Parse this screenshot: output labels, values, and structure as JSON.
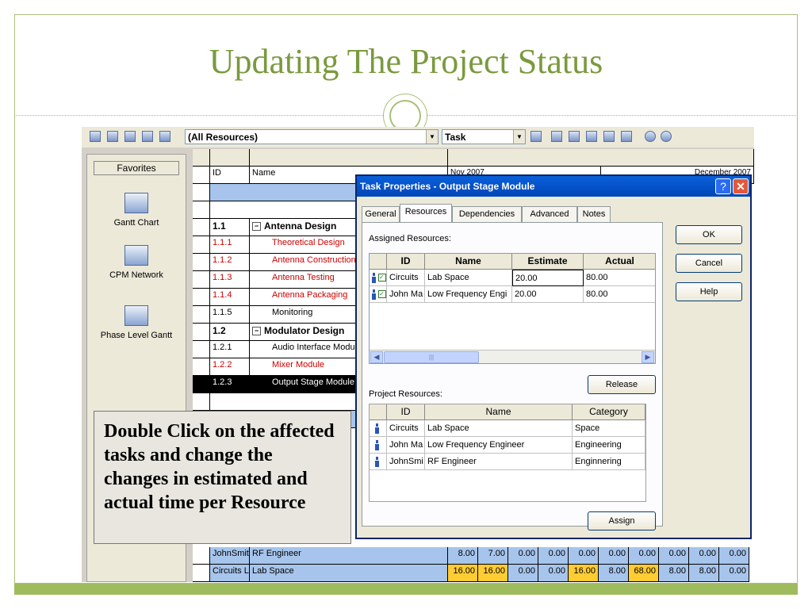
{
  "slide": {
    "title": "Updating The Project Status",
    "callout": "Double Click on the affected tasks and change the changes in estimated and actual time per Resource"
  },
  "toolbar": {
    "resource_filter": "(All Resources)",
    "view_filter": "Task"
  },
  "favorites": {
    "header": "Favorites",
    "items": [
      {
        "label": "Gantt Chart",
        "icon": "gantt-chart-icon"
      },
      {
        "label": "CPM Network",
        "icon": "cpm-network-icon"
      },
      {
        "label": "Phase Level Gantt",
        "icon": "phase-gantt-icon"
      }
    ]
  },
  "task_grid": {
    "col_id": "ID",
    "col_name": "Name",
    "timeline_months": [
      "Nov 2007",
      "December 2007"
    ],
    "rows": [
      {
        "id": "1.1",
        "name": "Antenna Design",
        "style": "summary"
      },
      {
        "id": "1.1.1",
        "name": "Theoretical Design",
        "style": "red"
      },
      {
        "id": "1.1.2",
        "name": "Antenna Construction",
        "style": "red"
      },
      {
        "id": "1.1.3",
        "name": "Antenna Testing",
        "style": "red"
      },
      {
        "id": "1.1.4",
        "name": "Antenna Packaging",
        "style": "red"
      },
      {
        "id": "1.1.5",
        "name": "Monitoring",
        "style": "normal"
      },
      {
        "id": "1.2",
        "name": "Modulator Design",
        "style": "summary"
      },
      {
        "id": "1.2.1",
        "name": "Audio Interface Module",
        "style": "normal"
      },
      {
        "id": "1.2.2",
        "name": "Mixer Module",
        "style": "red"
      },
      {
        "id": "1.2.3",
        "name": "Output Stage Module",
        "style": "selected"
      }
    ]
  },
  "resource_usage": {
    "rows": [
      {
        "id": "JohnSmith",
        "name": "RF Engineer",
        "values": [
          "8.00",
          "7.00",
          "0.00",
          "0.00",
          "0.00",
          "0.00",
          "0.00",
          "0.00",
          "0.00",
          "0.00"
        ],
        "highlight": [
          false,
          false,
          false,
          false,
          false,
          false,
          false,
          false,
          false,
          false
        ]
      },
      {
        "id": "Circuits L",
        "name": "Lab Space",
        "values": [
          "16.00",
          "16.00",
          "0.00",
          "0.00",
          "16.00",
          "8.00",
          "68.00",
          "8.00",
          "8.00",
          "0.00"
        ],
        "highlight": [
          true,
          true,
          false,
          false,
          true,
          false,
          true,
          false,
          false,
          false
        ]
      }
    ]
  },
  "dialog": {
    "title": "Task Properties - Output Stage Module",
    "help_glyph": "?",
    "close_glyph": "✕",
    "tabs": [
      "General",
      "Resources",
      "Dependencies",
      "Advanced",
      "Notes"
    ],
    "active_tab": "Resources",
    "assigned_label": "Assigned Resources:",
    "assigned_headers": [
      "ID",
      "Name",
      "Estimate",
      "Actual"
    ],
    "assigned_rows": [
      {
        "id": "Circuits",
        "name": "Lab Space",
        "estimate": "20.00",
        "actual": "80.00"
      },
      {
        "id": "John Ma",
        "name": "Low Frequency Engi",
        "estimate": "20.00",
        "actual": "80.00"
      }
    ],
    "release_button": "Release",
    "project_label": "Project Resources:",
    "project_headers": [
      "ID",
      "Name",
      "Category"
    ],
    "project_rows": [
      {
        "id": "Circuits",
        "name": "Lab Space",
        "category": "Space"
      },
      {
        "id": "John Ma",
        "name": "Low Frequency Engineer",
        "category": "Engineering"
      },
      {
        "id": "JohnSmi",
        "name": "RF Engineer",
        "category": "Enginnering"
      }
    ],
    "assign_button": "Assign",
    "ok_button": "OK",
    "cancel_button": "Cancel",
    "help_button": "Help"
  },
  "colors": {
    "accent": "#7a9a3e",
    "frame": "#a9c07a",
    "row_blue": "#a7c5ec",
    "highlight_yellow": "#ffcc33",
    "title_bar": "#0a5fd9"
  }
}
